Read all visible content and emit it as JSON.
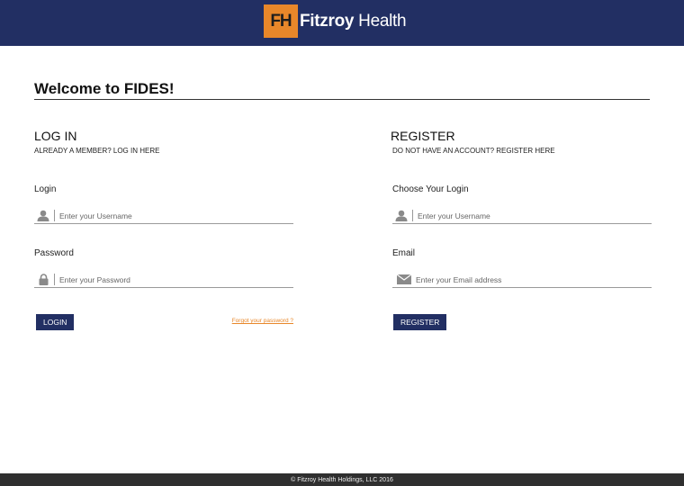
{
  "header": {
    "logo_mark": "FH",
    "logo_word_bold": "Fitzroy",
    "logo_word_regular": "Health",
    "bg_color": "#222f63",
    "accent": "#e8872a"
  },
  "page": {
    "welcome": "Welcome to FIDES!"
  },
  "login": {
    "title": "LOG IN",
    "subtitle": "ALREADY A MEMBER? LOG IN HERE",
    "username_label": "Login",
    "username_placeholder": "Enter your Username",
    "username_icon": "user-icon",
    "password_label": "Password",
    "password_placeholder": "Enter your Password",
    "password_icon": "lock-icon",
    "button": "LOGIN",
    "forgot": "Forgot your password ?"
  },
  "register": {
    "title": "REGISTER",
    "subtitle": "DO NOT HAVE AN ACCOUNT? REGISTER HERE",
    "username_label": "Choose Your Login",
    "username_placeholder": "Enter your Username",
    "username_icon": "user-icon",
    "email_label": "Email",
    "email_placeholder": "Enter your Email address",
    "email_icon": "envelope-icon",
    "button": "REGISTER"
  },
  "footer": {
    "text": "© Fitzroy Health Holdings, LLC 2016"
  }
}
